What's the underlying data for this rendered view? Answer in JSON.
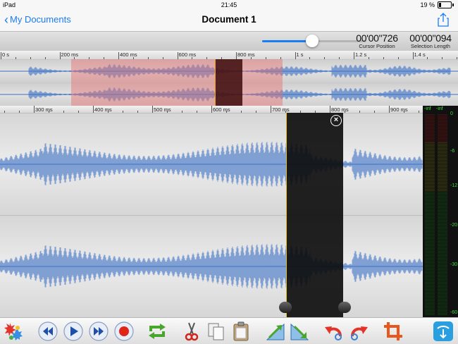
{
  "status": {
    "device": "iPad",
    "time": "21:45",
    "battery": "19 %"
  },
  "nav": {
    "back_label": "My Documents",
    "title": "Document 1"
  },
  "position": {
    "cursor_value": "00'00\"726",
    "cursor_label": "Cursor Position",
    "selection_value": "00'00\"094",
    "selection_label": "Selection Length",
    "slider_level": 0.48
  },
  "overview_ruler": {
    "ticks": [
      "0 s",
      "200 ms",
      "400 ms",
      "600 ms",
      "800 ms",
      "1 s",
      "1.2 s",
      "1.4 s"
    ]
  },
  "main_ruler": {
    "ticks": [
      "300 ms",
      "400 ms",
      "500 ms",
      "600 ms",
      "700 ms",
      "800 ms",
      "900 ms"
    ]
  },
  "meters": {
    "left_label": "-inf",
    "right_label": "-inf",
    "scale": [
      "0",
      "-6",
      "-12",
      "-20",
      "-30",
      "-60"
    ]
  },
  "toolbar": {
    "items": [
      "effects-icon",
      "rewind-icon",
      "play-icon",
      "fast-forward-icon",
      "record-icon",
      "loop-icon",
      "cut-icon",
      "copy-icon",
      "paste-icon",
      "fade-in-icon",
      "fade-out-icon",
      "undo-icon",
      "redo-icon",
      "crop-icon",
      "export-icon"
    ]
  },
  "colors": {
    "accent": "#1a7cf5",
    "waveform": "#3a6fc4",
    "selection_border": "#e8c000",
    "view_region": "#e66e6e",
    "record": "#e0251b",
    "meter_green": "#3ddc3d"
  }
}
